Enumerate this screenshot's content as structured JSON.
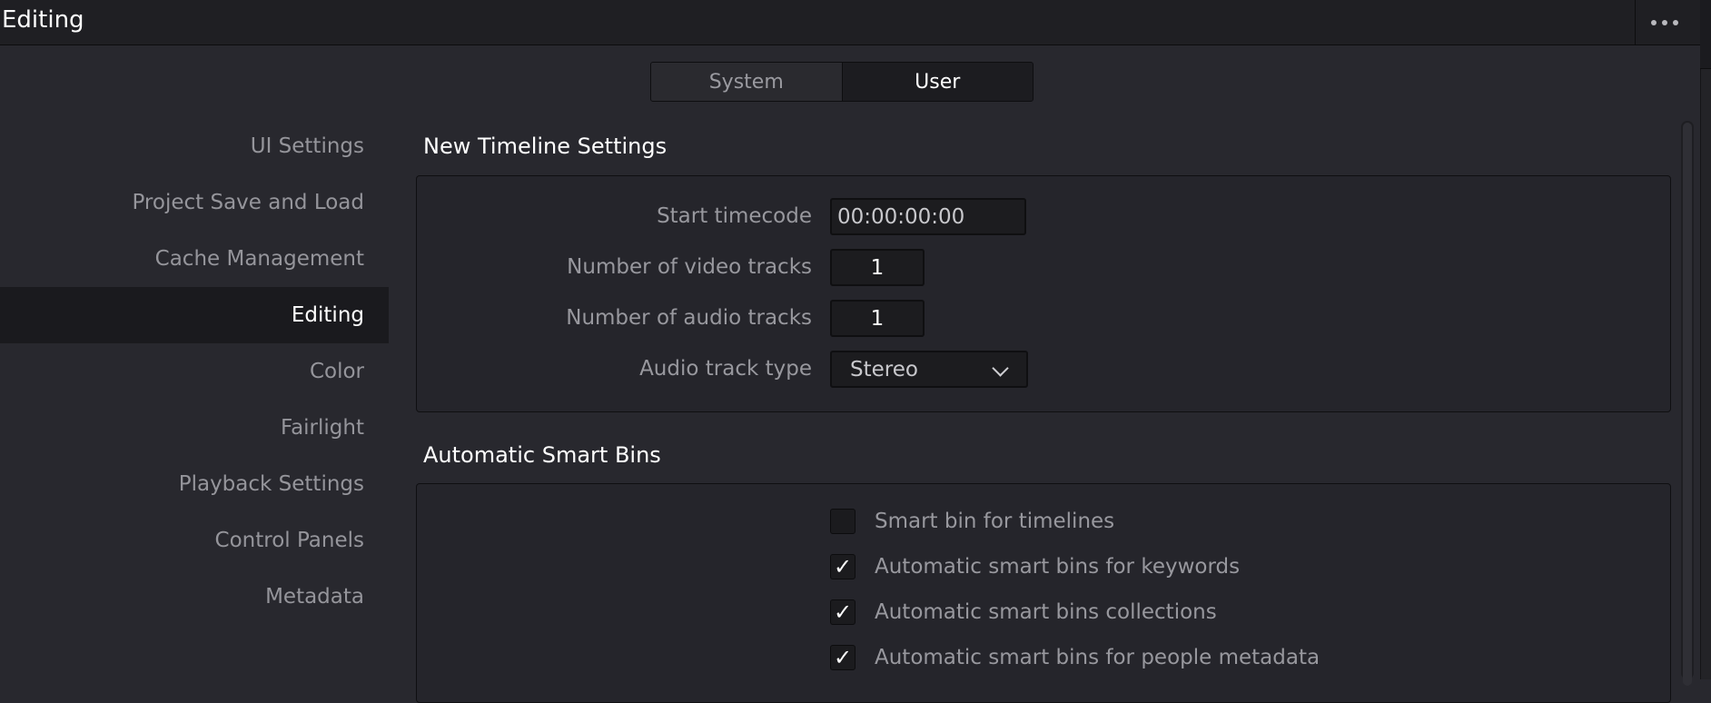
{
  "window": {
    "title": "Editing"
  },
  "tabs": [
    {
      "label": "System",
      "selected": false
    },
    {
      "label": "User",
      "selected": true
    }
  ],
  "nav": {
    "items": [
      {
        "label": "UI Settings",
        "active": false
      },
      {
        "label": "Project Save and Load",
        "active": false
      },
      {
        "label": "Cache Management",
        "active": false
      },
      {
        "label": "Editing",
        "active": true
      },
      {
        "label": "Color",
        "active": false
      },
      {
        "label": "Fairlight",
        "active": false
      },
      {
        "label": "Playback Settings",
        "active": false
      },
      {
        "label": "Control Panels",
        "active": false
      },
      {
        "label": "Metadata",
        "active": false
      }
    ]
  },
  "new_timeline": {
    "title": "New Timeline Settings",
    "start_timecode": {
      "label": "Start timecode",
      "value": "00:00:00:00"
    },
    "video_tracks": {
      "label": "Number of video tracks",
      "value": "1"
    },
    "audio_tracks": {
      "label": "Number of audio tracks",
      "value": "1"
    },
    "audio_type": {
      "label": "Audio track type",
      "value": "Stereo"
    }
  },
  "smart_bins": {
    "title": "Automatic Smart Bins",
    "options": [
      {
        "label": "Smart bin for timelines",
        "checked": false
      },
      {
        "label": "Automatic smart bins for keywords",
        "checked": true
      },
      {
        "label": "Automatic smart bins collections",
        "checked": true
      },
      {
        "label": "Automatic smart bins for people metadata",
        "checked": true
      }
    ]
  },
  "icons": {
    "more": "more-horizontal-icon",
    "checkmark": "✓",
    "dropdown": "chevron-down-icon"
  },
  "colors": {
    "background": "#28282e",
    "active_nav": "#1a1a1e",
    "text_active": "#ffffff",
    "text_muted": "#98989e"
  }
}
